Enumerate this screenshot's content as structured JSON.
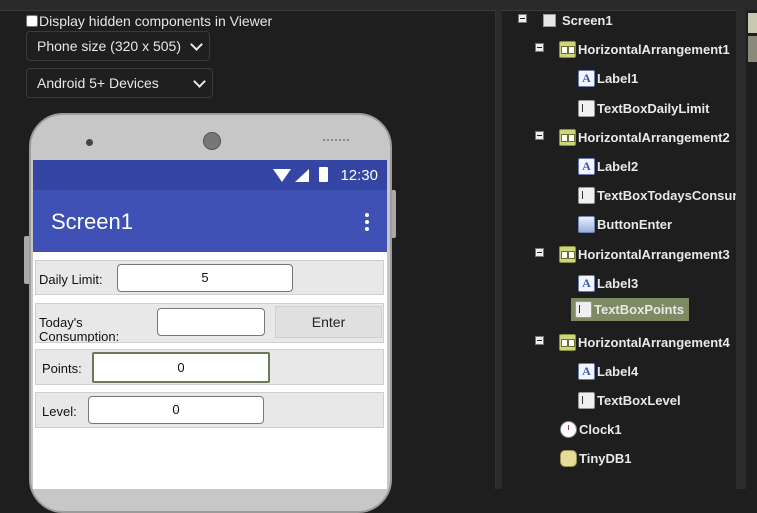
{
  "viewer": {
    "hidden_label": "Display hidden components in Viewer",
    "phone_size": "Phone size (320 x 505)",
    "device": "Android 5+ Devices"
  },
  "phone": {
    "time": "12:30",
    "screen_title": "Screen1",
    "rows": {
      "daily_limit_label": "Daily Limit:",
      "daily_limit_value": "5",
      "consumption_label": "Today's Consumption:",
      "consumption_value": "",
      "enter_button": "Enter",
      "points_label": "Points:",
      "points_value": "0",
      "level_label": "Level:",
      "level_value": "0"
    }
  },
  "tree": {
    "screen": "Screen1",
    "ha1": "HorizontalArrangement1",
    "label1": "Label1",
    "tb_daily": "TextBoxDailyLimit",
    "ha2": "HorizontalArrangement2",
    "label2": "Label2",
    "tb_today": "TextBoxTodaysConsur",
    "btn_enter": "ButtonEnter",
    "ha3": "HorizontalArrangement3",
    "label3": "Label3",
    "tb_points": "TextBoxPoints",
    "ha4": "HorizontalArrangement4",
    "label4": "Label4",
    "tb_level": "TextBoxLevel",
    "clock": "Clock1",
    "db": "TinyDB1"
  },
  "icon_letters": {
    "label": "A"
  },
  "colors": {
    "statusbar": "#3545a3",
    "appbar": "#3f51b5",
    "selection": "#7e8a62"
  }
}
